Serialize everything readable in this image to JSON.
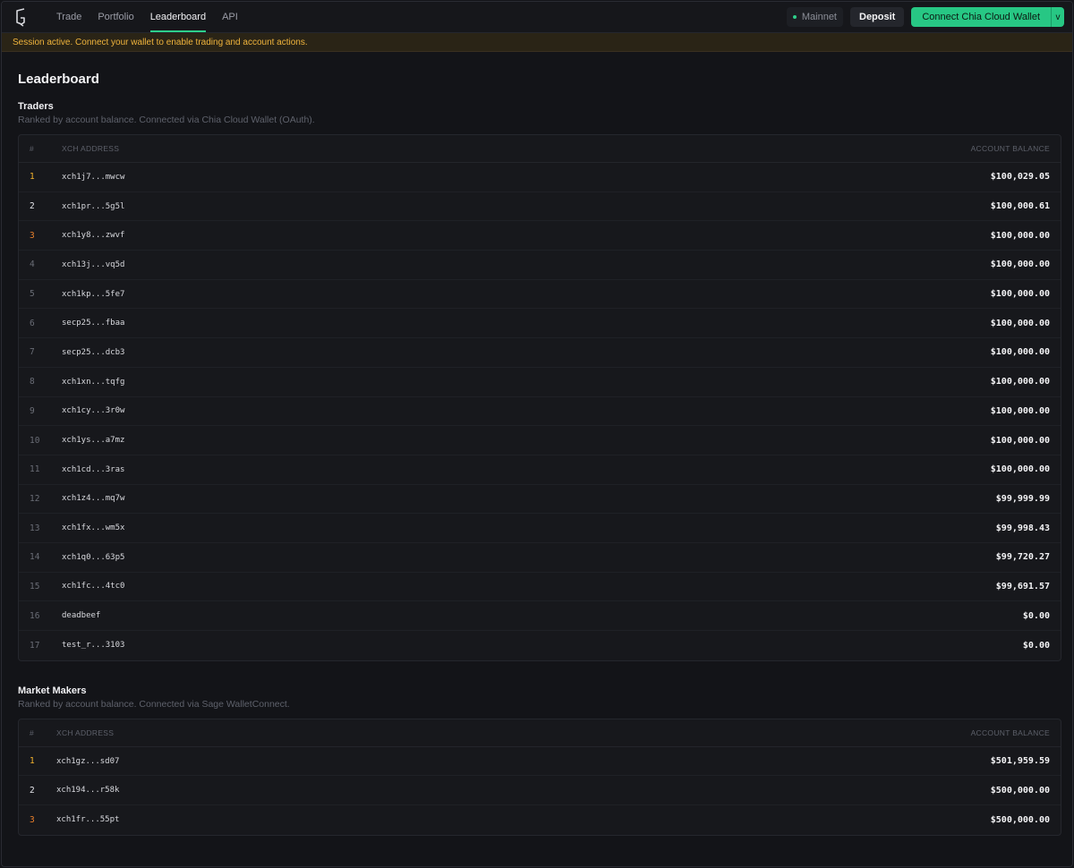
{
  "nav": {
    "items": [
      {
        "label": "Trade",
        "active": false
      },
      {
        "label": "Portfolio",
        "active": false
      },
      {
        "label": "Leaderboard",
        "active": true
      },
      {
        "label": "API",
        "active": false
      }
    ],
    "network_label": "Mainnet",
    "deposit_label": "Deposit",
    "connect_label": "Connect Chia Cloud Wallet",
    "connect_caret": "v"
  },
  "banner": {
    "text": "Session active. Connect your wallet to enable trading and account actions."
  },
  "page": {
    "title": "Leaderboard"
  },
  "traders": {
    "title": "Traders",
    "subtitle": "Ranked by account balance. Connected via Chia Cloud Wallet (OAuth).",
    "headers": {
      "rank": "#",
      "address": "XCH ADDRESS",
      "balance": "ACCOUNT BALANCE"
    },
    "rows": [
      {
        "rank": "1",
        "address": "xch1j7...mwcw",
        "balance": "$100,029.05"
      },
      {
        "rank": "2",
        "address": "xch1pr...5g5l",
        "balance": "$100,000.61"
      },
      {
        "rank": "3",
        "address": "xch1y8...zwvf",
        "balance": "$100,000.00"
      },
      {
        "rank": "4",
        "address": "xch13j...vq5d",
        "balance": "$100,000.00"
      },
      {
        "rank": "5",
        "address": "xch1kp...5fe7",
        "balance": "$100,000.00"
      },
      {
        "rank": "6",
        "address": "secp25...fbaa",
        "balance": "$100,000.00"
      },
      {
        "rank": "7",
        "address": "secp25...dcb3",
        "balance": "$100,000.00"
      },
      {
        "rank": "8",
        "address": "xch1xn...tqfg",
        "balance": "$100,000.00"
      },
      {
        "rank": "9",
        "address": "xch1cy...3r0w",
        "balance": "$100,000.00"
      },
      {
        "rank": "10",
        "address": "xch1ys...a7mz",
        "balance": "$100,000.00"
      },
      {
        "rank": "11",
        "address": "xch1cd...3ras",
        "balance": "$100,000.00"
      },
      {
        "rank": "12",
        "address": "xch1z4...mq7w",
        "balance": "$99,999.99"
      },
      {
        "rank": "13",
        "address": "xch1fx...wm5x",
        "balance": "$99,998.43"
      },
      {
        "rank": "14",
        "address": "xch1q0...63p5",
        "balance": "$99,720.27"
      },
      {
        "rank": "15",
        "address": "xch1fc...4tc0",
        "balance": "$99,691.57"
      },
      {
        "rank": "16",
        "address": "deadbeef",
        "balance": "$0.00"
      },
      {
        "rank": "17",
        "address": "test_r...3103",
        "balance": "$0.00"
      }
    ]
  },
  "market_makers": {
    "title": "Market Makers",
    "subtitle": "Ranked by account balance. Connected via Sage WalletConnect.",
    "headers": {
      "rank": "#",
      "address": "XCH ADDRESS",
      "balance": "ACCOUNT BALANCE"
    },
    "rows": [
      {
        "rank": "1",
        "address": "xch1gz...sd07",
        "balance": "$501,959.59"
      },
      {
        "rank": "2",
        "address": "xch194...r58k",
        "balance": "$500,000.00"
      },
      {
        "rank": "3",
        "address": "xch1fr...55pt",
        "balance": "$500,000.00"
      }
    ]
  },
  "colors": {
    "accent": "#27c784",
    "gold": "#f3b22c",
    "bronze": "#e77e2b",
    "banner_text": "#f0b43c"
  }
}
